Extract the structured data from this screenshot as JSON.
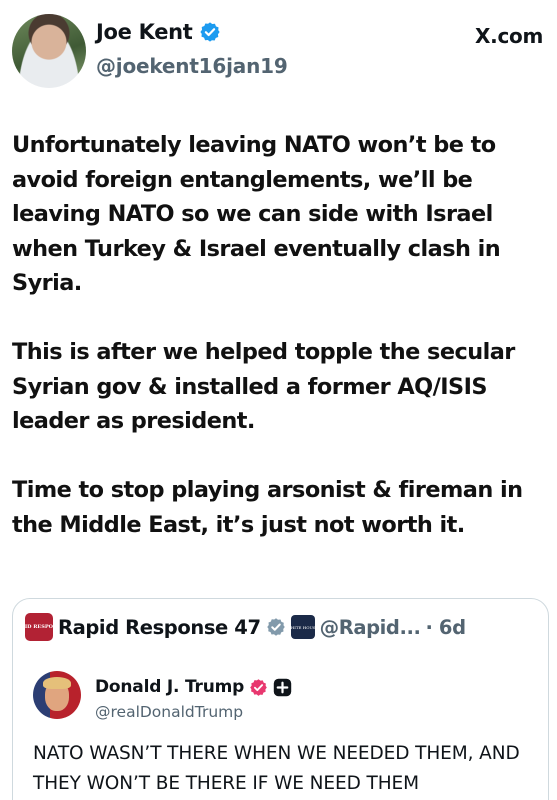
{
  "author": {
    "name": "Joe Kent",
    "handle": "@joekent16jan19",
    "site_label": "X.com"
  },
  "tweet": {
    "paragraphs": [
      "Unfortunately leaving NATO won’t be to avoid foreign entanglements, we’ll be leaving NATO so we can side with Israel when Turkey & Israel eventually clash in Syria.",
      "This is after we helped topple the secular Syrian gov & installed a former AQ/ISIS leader as president.",
      "Time to stop playing arsonist & fireman in the Middle East, it’s just not worth it."
    ]
  },
  "quoted": {
    "name": "Rapid Response 47",
    "logo_text": "RAPID RESPONSE",
    "affiliate_text": "WHITE HOUSE",
    "handle": "@Rapid...",
    "time": "· 6d",
    "inner": {
      "name": "Donald J. Trump",
      "handle": "@realDonaldTrump",
      "text": "NATO WASN’T THERE WHEN WE NEEDED THEM, AND THEY WON’T BE THERE IF WE NEED THEM"
    }
  },
  "colors": {
    "verified_blue": "#1d9bf0",
    "verified_gray": "#829aab",
    "verified_pink": "#e8386f",
    "muted_text": "#536471",
    "border": "#cfd9de"
  }
}
